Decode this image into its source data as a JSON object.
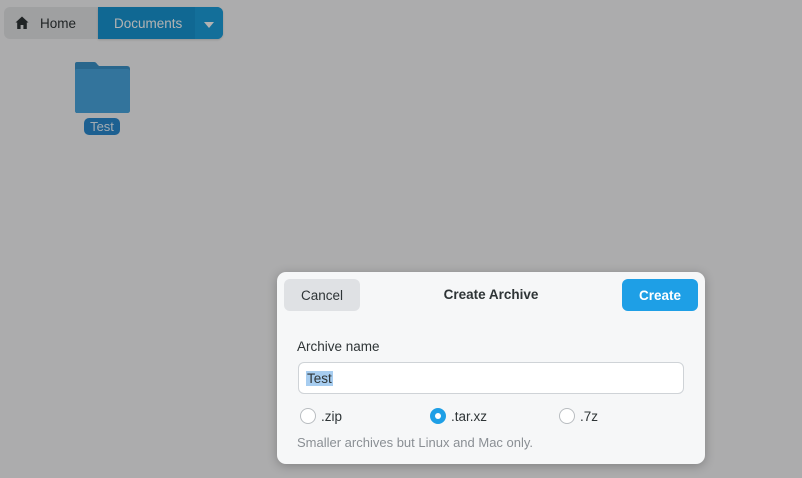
{
  "breadcrumb": {
    "home_label": "Home",
    "current_label": "Documents"
  },
  "files": [
    {
      "name": "Test",
      "icon": "folder-icon"
    }
  ],
  "dialog": {
    "title": "Create Archive",
    "cancel_label": "Cancel",
    "create_label": "Create",
    "archive_name_label": "Archive name",
    "archive_name_value": "Test",
    "formats": [
      {
        "label": ".zip",
        "selected": false
      },
      {
        "label": ".tar.xz",
        "selected": true
      },
      {
        "label": ".7z",
        "selected": false
      }
    ],
    "hint": "Smaller archives but Linux and Mac only."
  },
  "colors": {
    "accent": "#1e9fe6",
    "breadcrumb_active": "#1896d3",
    "selection": "#a7cdf0"
  }
}
